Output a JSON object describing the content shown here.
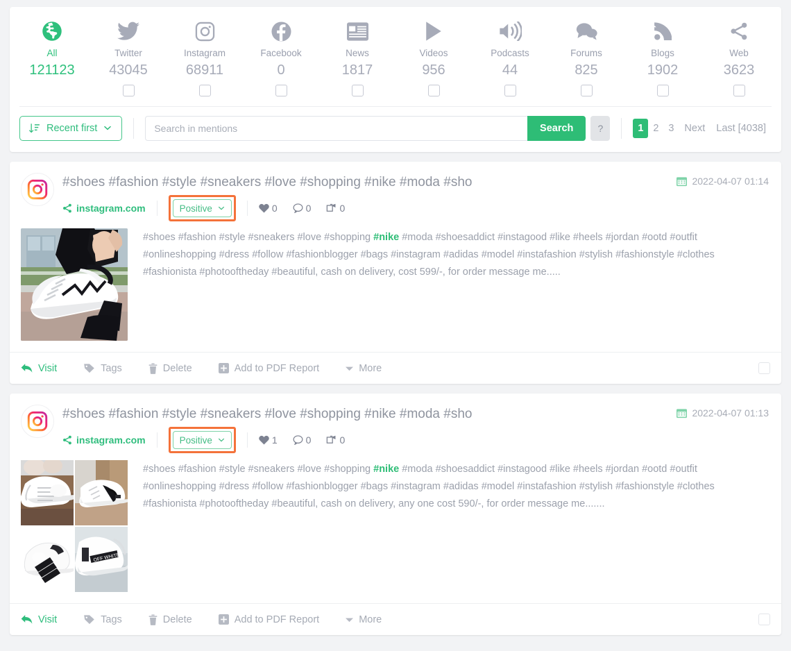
{
  "sources": [
    {
      "name": "All",
      "count": "121123",
      "icon": "globe-icon",
      "active": true,
      "checkbox": false
    },
    {
      "name": "Twitter",
      "count": "43045",
      "icon": "twitter-icon",
      "active": false,
      "checkbox": true
    },
    {
      "name": "Instagram",
      "count": "68911",
      "icon": "instagram-icon",
      "active": false,
      "checkbox": true
    },
    {
      "name": "Facebook",
      "count": "0",
      "icon": "facebook-icon",
      "active": false,
      "checkbox": true
    },
    {
      "name": "News",
      "count": "1817",
      "icon": "news-icon",
      "active": false,
      "checkbox": true
    },
    {
      "name": "Videos",
      "count": "956",
      "icon": "play-icon",
      "active": false,
      "checkbox": true
    },
    {
      "name": "Podcasts",
      "count": "44",
      "icon": "speaker-icon",
      "active": false,
      "checkbox": true
    },
    {
      "name": "Forums",
      "count": "825",
      "icon": "comments-icon",
      "active": false,
      "checkbox": true
    },
    {
      "name": "Blogs",
      "count": "1902",
      "icon": "rss-icon",
      "active": false,
      "checkbox": true
    },
    {
      "name": "Web",
      "count": "3623",
      "icon": "share-icon",
      "active": false,
      "checkbox": true
    }
  ],
  "toolbar": {
    "sort_label": "Recent first",
    "sort_icon": "sort-descending-icon",
    "search_placeholder": "Search in mentions",
    "search_value": "",
    "search_button": "Search",
    "help_button": "?"
  },
  "pagination": {
    "pages": [
      "1",
      "2",
      "3"
    ],
    "current": "1",
    "next_label": "Next",
    "last_label": "Last [4038]"
  },
  "mentions": [
    {
      "avatar_icon": "instagram-icon",
      "title": "#shoes #fashion #style #sneakers #love #shopping #nike #moda #sho",
      "domain": "instagram.com",
      "domain_icon": "share-icon",
      "sentiment": "Positive",
      "sentiment_highlighted": true,
      "likes": "0",
      "comments": "0",
      "shares": "0",
      "date": "2022-04-07 01:14",
      "date_icon": "calendar-icon",
      "snippet_pre": "#shoes #fashion #style #sneakers #love #shopping ",
      "snippet_hl": "#nike",
      "snippet_post": " #moda #shoesaddict #instagood #like #heels #jordan #ootd #outfit #onlineshopping #dress #follow #fashionblogger #bags #instagram #adidas #model #instafashion #stylish #fashionstyle #clothes #fashionista #photooftheday #beautiful, cash on delivery, cost 599/-, for order message me.....",
      "thumb_type": "single"
    },
    {
      "avatar_icon": "instagram-icon",
      "title": "#shoes #fashion #style #sneakers #love #shopping #nike #moda #sho",
      "domain": "instagram.com",
      "domain_icon": "share-icon",
      "sentiment": "Positive",
      "sentiment_highlighted": true,
      "likes": "1",
      "comments": "0",
      "shares": "0",
      "date": "2022-04-07 01:13",
      "date_icon": "calendar-icon",
      "snippet_pre": "#shoes #fashion #style #sneakers #love #shopping ",
      "snippet_hl": "#nike",
      "snippet_post": " #moda #shoesaddict #instagood #like #heels #jordan #ootd #outfit #onlineshopping #dress #follow #fashionblogger #bags #instagram #adidas #model #instafashion #stylish #fashionstyle #clothes #fashionista #photooftheday #beautiful, cash on delivery, any one cost 590/-, for order message me.......",
      "thumb_type": "grid"
    }
  ],
  "actions": {
    "visit": "Visit",
    "tags": "Tags",
    "delete": "Delete",
    "add_pdf": "Add to PDF Report",
    "more": "More",
    "visit_icon": "reply-arrow-icon",
    "tags_icon": "tag-icon",
    "delete_icon": "trash-icon",
    "pdf_icon": "plus-square-icon",
    "more_icon": "caret-down-icon"
  },
  "colors": {
    "green": "#2ebd76",
    "orange_highlight": "#f4723a",
    "muted": "#9ca1ac",
    "background": "#f2f3f5"
  }
}
